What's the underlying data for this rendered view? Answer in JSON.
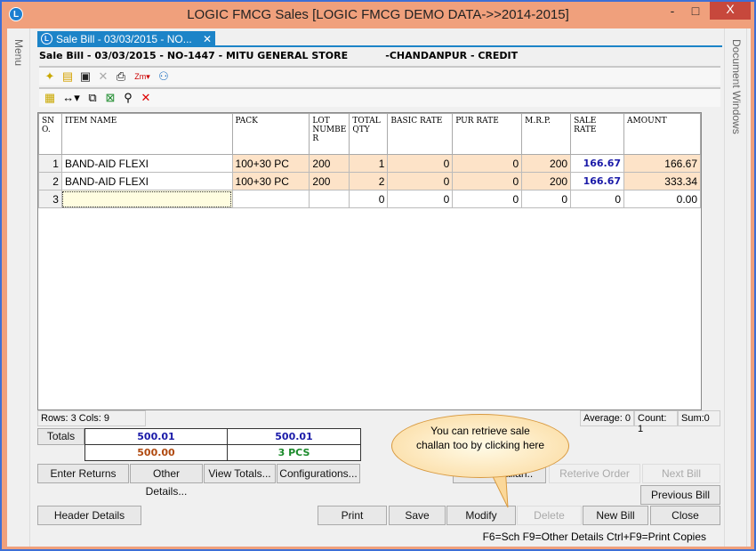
{
  "window": {
    "title": "LOGIC FMCG Sales  [LOGIC FMCG DEMO DATA->>2014-2015]",
    "minimize": "-",
    "maximize": "□",
    "close": "X"
  },
  "side": {
    "left": "Menu",
    "right": "Document Windows"
  },
  "tab": {
    "label": "Sale Bill - 03/03/2015 - NO...",
    "close": "✕"
  },
  "header": {
    "text": "Sale Bill - 03/03/2015 - NO-1447 - MITU GENERAL STORE           -CHANDANPUR - CREDIT"
  },
  "toolbar1": [
    "new-icon",
    "open-icon",
    "save-icon",
    "delete-icon",
    "print-icon",
    "zoom-icon",
    "users-icon"
  ],
  "toolbar2": [
    "calculator-icon",
    "column-width-icon",
    "copy-icon",
    "excel-icon",
    "find-icon",
    "cancel-icon"
  ],
  "grid": {
    "columns": [
      "SN O.",
      "ITEM NAME",
      "PACK",
      "LOT NUMBE R",
      "TOTAL QTY",
      "BASIC RATE",
      "PUR RATE",
      "M.R.P.",
      "SALE RATE",
      "AMOUNT"
    ],
    "rows": [
      [
        "1",
        "BAND-AID FLEXI",
        "100+30 PC",
        "200",
        "1",
        "0",
        "0",
        "200",
        "166.67",
        "166.67"
      ],
      [
        "2",
        "BAND-AID FLEXI",
        "100+30 PC",
        "200",
        "2",
        "0",
        "0",
        "200",
        "166.67",
        "333.34"
      ],
      [
        "3",
        "",
        "",
        "",
        "0",
        "0",
        "0",
        "0",
        "0",
        "0.00"
      ]
    ]
  },
  "status": {
    "rows_cols": "Rows: 3  Cols: 9",
    "average": "Average: 0",
    "count": "Count: 1",
    "sum": "Sum:0"
  },
  "totals": {
    "label": "Totals",
    "v1": "500.01",
    "v2": "500.01",
    "v3": "500.00",
    "v4": "3 PCS"
  },
  "callout": "You can retrieve sale challan too by clicking here",
  "buttons": {
    "enter_returns": "Enter Returns",
    "other_details": "Other Details...",
    "view_totals": "View Totals...",
    "configurations": "Configurations...",
    "retv_challan": "Retv Challan..",
    "reterive_order": "Reterive Order",
    "next_bill": "Next Bill",
    "previous_bill": "Previous Bill",
    "header_details": "Header Details",
    "print": "Print",
    "save": "Save",
    "modify": "Modify",
    "delete": "Delete",
    "new_bill": "New Bill",
    "close": "Close"
  },
  "shortcuts": "F6=Sch F9=Other Details Ctrl+F9=Print Copies"
}
